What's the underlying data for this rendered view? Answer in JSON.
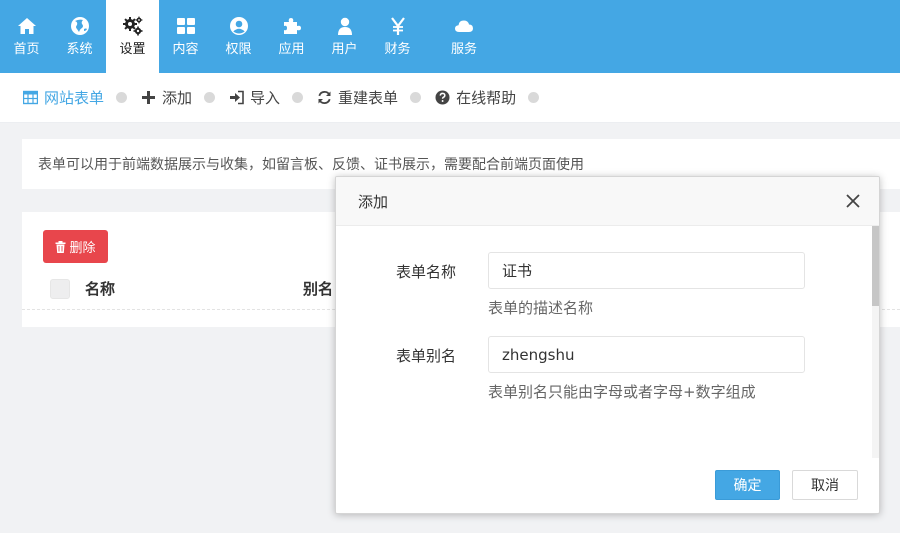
{
  "topnav": {
    "items": [
      {
        "label": "首页",
        "icon": "home-icon"
      },
      {
        "label": "系统",
        "icon": "globe-icon"
      },
      {
        "label": "设置",
        "icon": "gears-icon",
        "active": true
      },
      {
        "label": "内容",
        "icon": "grid-icon"
      },
      {
        "label": "权限",
        "icon": "user-circle-icon"
      },
      {
        "label": "应用",
        "icon": "puzzle-icon"
      },
      {
        "label": "用户",
        "icon": "user-icon"
      },
      {
        "label": "财务",
        "icon": "yen-icon"
      },
      {
        "label": "服务",
        "icon": "cloud-icon"
      }
    ]
  },
  "toolbar": {
    "items": [
      {
        "label": "网站表单",
        "icon": "table-icon",
        "active": true
      },
      {
        "label": "添加",
        "icon": "plus-icon"
      },
      {
        "label": "导入",
        "icon": "sign-in-icon"
      },
      {
        "label": "重建表单",
        "icon": "refresh-icon"
      },
      {
        "label": "在线帮助",
        "icon": "question-circle-icon"
      }
    ]
  },
  "info": {
    "text": "表单可以用于前端数据展示与收集，如留言板、反馈、证书展示，需要配合前端页面使用"
  },
  "table": {
    "delete_label": "删除",
    "columns": [
      "名称",
      "别名"
    ]
  },
  "modal": {
    "title": "添加",
    "fields": [
      {
        "label": "表单名称",
        "value": "证书",
        "help": "表单的描述名称"
      },
      {
        "label": "表单别名",
        "value": "zhengshu",
        "help": "表单别名只能由字母或者字母+数字组成"
      }
    ],
    "ok_label": "确定",
    "cancel_label": "取消"
  },
  "colors": {
    "primary": "#44a7e4",
    "danger": "#e8464c"
  }
}
